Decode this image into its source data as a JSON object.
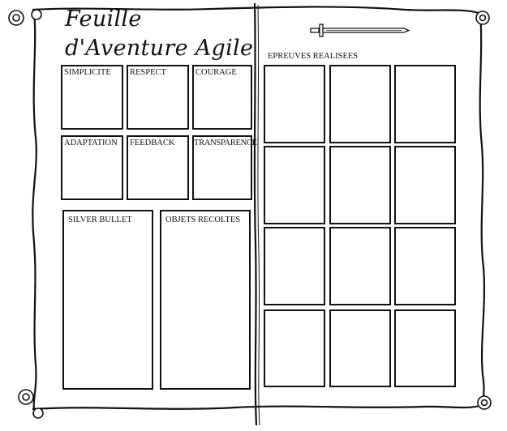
{
  "title": {
    "line1": "Feuille",
    "line2": "d'Aventure Agile"
  },
  "values_grid": [
    "SIMPLICITE",
    "RESPECT",
    "COURAGE",
    "ADAPTATION",
    "FEEDBACK",
    "TRANSPARENCE"
  ],
  "silver_bullet": "SILVER BULLET",
  "objets": "OBJETS RECOLTES",
  "epreuves": {
    "label": "EPREUVES REALISEES",
    "rows": 4,
    "cols": 3
  },
  "icons": [
    "scroll-background",
    "sword-icon",
    "scroll-curl-icon"
  ]
}
